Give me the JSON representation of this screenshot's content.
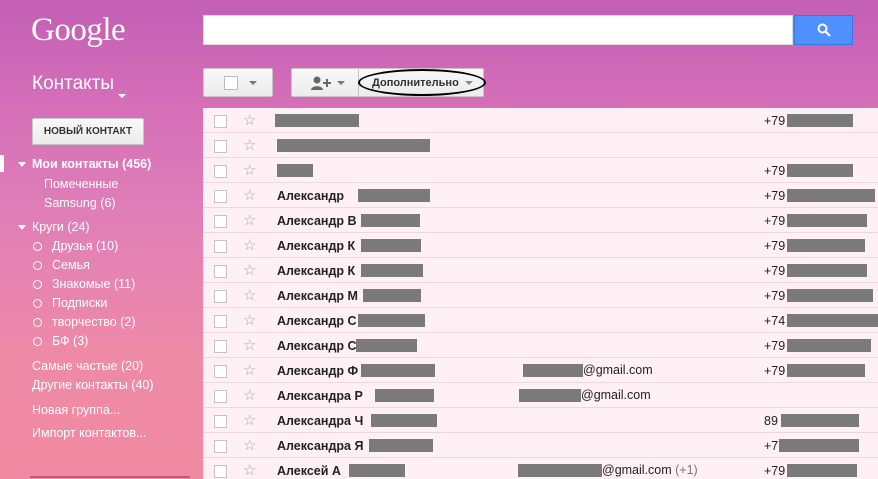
{
  "logo": "Google",
  "app_title": "Контакты",
  "toolbar": {
    "more_label": "Дополнительно"
  },
  "new_contact_label": "НОВЫЙ КОНТАКТ",
  "nav": {
    "my_contacts": "Мои контакты (456)",
    "starred": "Помеченные",
    "samsung": "Samsung (6)",
    "circles": "Круги (24)",
    "friends": "Друзья (10)",
    "family": "Семья",
    "acquaintances": "Знакомые (11)",
    "following": "Подписки",
    "creative": "творчество (2)",
    "bf": "БФ (3)",
    "frequent": "Самые частые (20)",
    "other": "Другие контакты (40)",
    "new_group": "Новая группа...",
    "import": "Импорт контактов..."
  },
  "rows": [
    {
      "name": "",
      "email": "",
      "extra": "",
      "phone": "+79"
    },
    {
      "name": "",
      "email": "",
      "extra": "",
      "phone": ""
    },
    {
      "name": "",
      "email": "",
      "extra": "",
      "phone": "+79"
    },
    {
      "name": "Александр",
      "email": "",
      "extra": "",
      "phone": "+79"
    },
    {
      "name": "Александр В",
      "email": "",
      "extra": "",
      "phone": "+79"
    },
    {
      "name": "Александр К",
      "email": "",
      "extra": "",
      "phone": "+79"
    },
    {
      "name": "Александр К",
      "email": "",
      "extra": "",
      "phone": "+79"
    },
    {
      "name": "Александр М",
      "email": "",
      "extra": "",
      "phone": "+79"
    },
    {
      "name": "Александр С",
      "email": "",
      "extra": "",
      "phone": "+74"
    },
    {
      "name": "Александр С",
      "email": "",
      "extra": "",
      "phone": "+79"
    },
    {
      "name": "Александр Ф",
      "email": "@gmail.com",
      "extra": "",
      "phone": "+79"
    },
    {
      "name": "Александра Р",
      "email": "@gmail.com",
      "extra": "",
      "phone": ""
    },
    {
      "name": "Александра Ч",
      "email": "",
      "extra": "",
      "phone": "89"
    },
    {
      "name": "Александра Я",
      "email": "",
      "extra": "",
      "phone": "+7"
    },
    {
      "name": "Алексей А",
      "email": "@gmail.com",
      "extra": "(+1)",
      "phone": "+79"
    }
  ]
}
